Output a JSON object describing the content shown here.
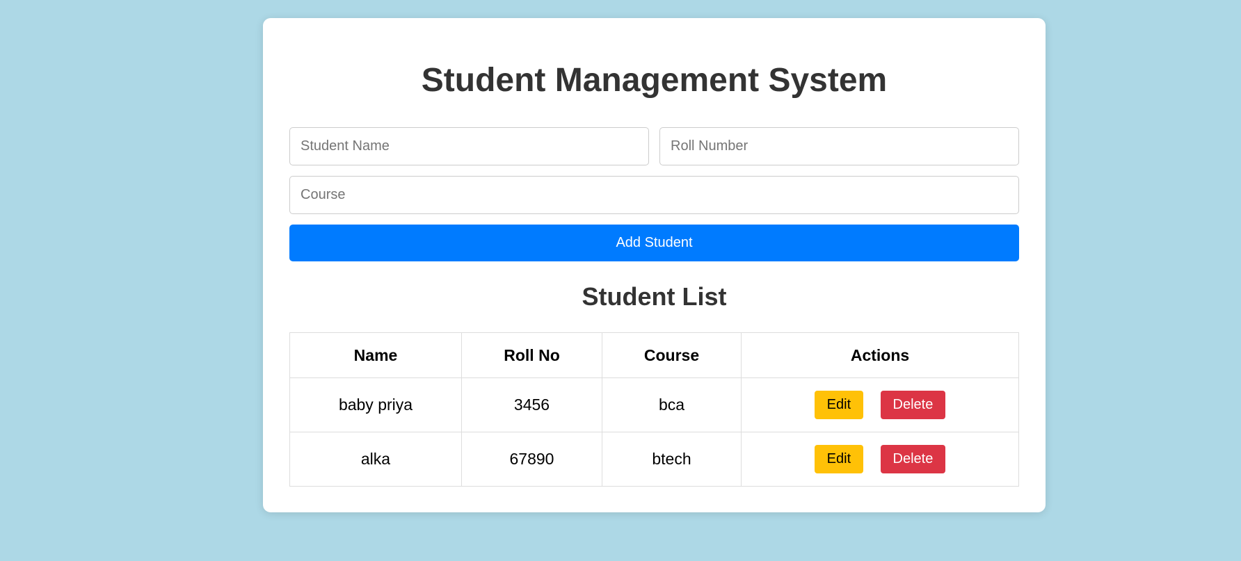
{
  "app": {
    "title": "Student Management System"
  },
  "form": {
    "name_placeholder": "Student Name",
    "roll_placeholder": "Roll Number",
    "course_placeholder": "Course",
    "add_label": "Add Student"
  },
  "list": {
    "title": "Student List",
    "headers": [
      "Name",
      "Roll No",
      "Course",
      "Actions"
    ],
    "rows": [
      {
        "name": "baby priya",
        "roll": "3456",
        "course": "bca"
      },
      {
        "name": "alka",
        "roll": "67890",
        "course": "btech"
      }
    ],
    "edit_label": "Edit",
    "delete_label": "Delete"
  },
  "colors": {
    "background": "#add8e6",
    "primary": "#007bff",
    "edit": "#ffc107",
    "delete": "#dc3545"
  }
}
